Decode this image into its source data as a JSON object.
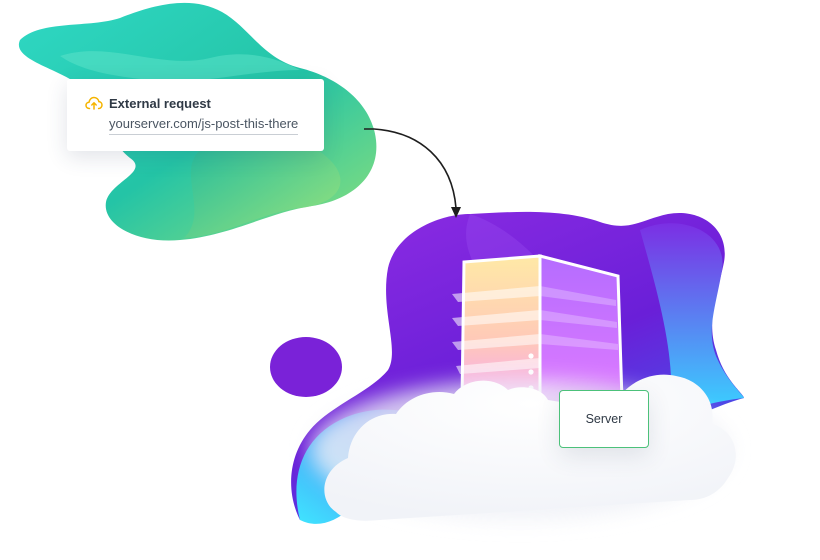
{
  "external_request": {
    "icon": "cloud-upload-icon",
    "title": "External request",
    "url": "yourserver.com/js-post-this-there"
  },
  "server": {
    "label": "Server",
    "icon": "server-tower-icon"
  },
  "colors": {
    "green_blob_start": "#2fd8c4",
    "green_blob_end": "#8ee07a",
    "purple_blob_start": "#7a1de0",
    "purple_blob_end": "#3fe6ff",
    "request_icon": "#f5b400",
    "server_border": "#4cc17a",
    "arrow": "#1e1e1e"
  }
}
